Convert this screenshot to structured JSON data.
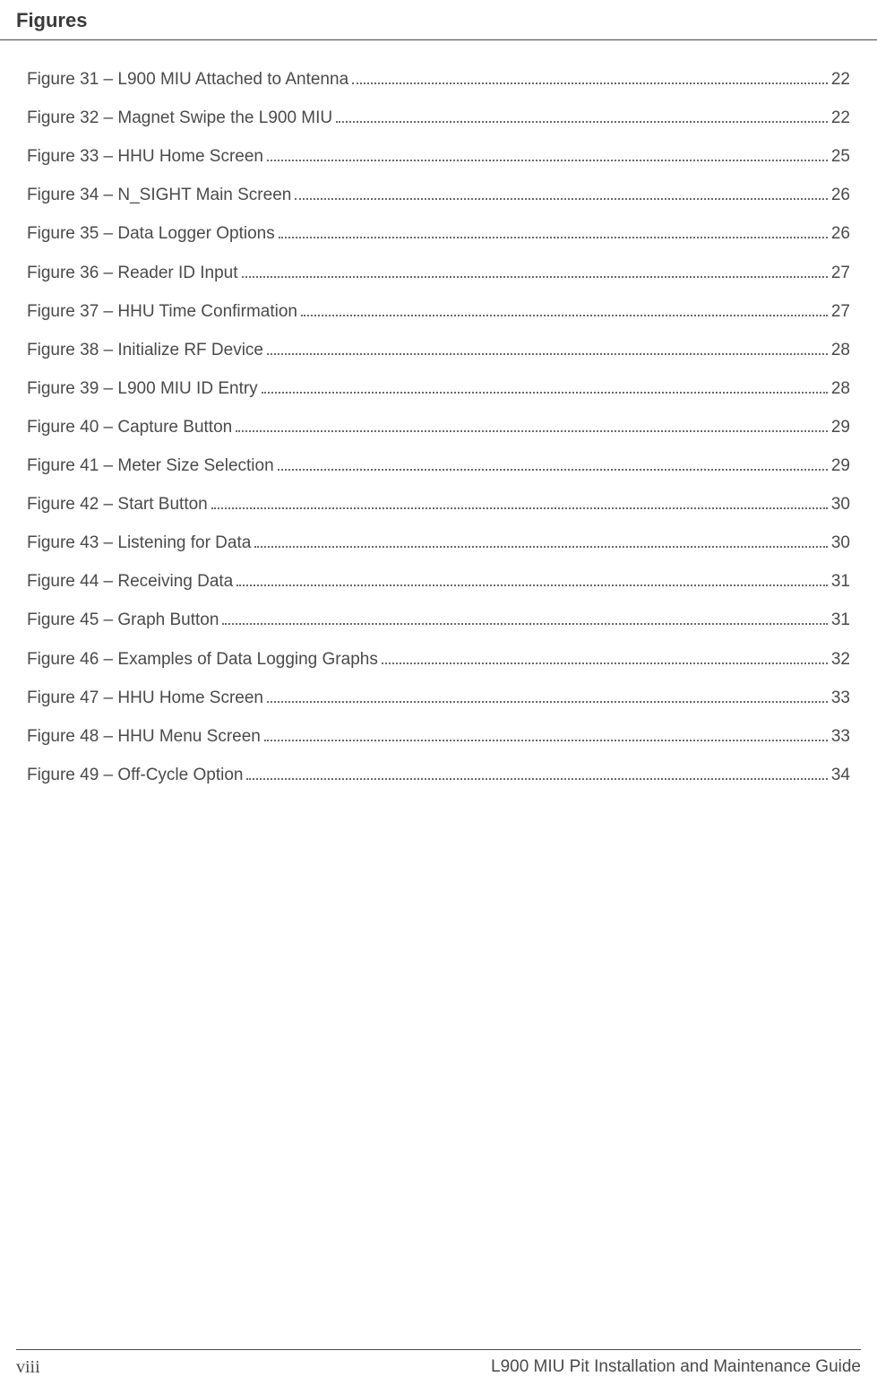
{
  "header": {
    "title": "Figures"
  },
  "figures": [
    {
      "num": "31",
      "title": "L900 MIU Attached to Antenna",
      "page": "22"
    },
    {
      "num": "32",
      "title": "Magnet Swipe the L900 MIU",
      "page": "22"
    },
    {
      "num": "33",
      "title": "HHU Home Screen",
      "page": "25"
    },
    {
      "num": "34",
      "title": "N_SIGHT Main Screen",
      "page": "26"
    },
    {
      "num": "35",
      "title": "Data Logger Options",
      "page": "26"
    },
    {
      "num": "36",
      "title": "Reader ID Input",
      "page": "27"
    },
    {
      "num": "37",
      "title": "HHU Time Confirmation",
      "page": "27"
    },
    {
      "num": "38",
      "title": "Initialize RF Device",
      "page": "28"
    },
    {
      "num": "39",
      "title": "L900 MIU ID Entry",
      "page": "28"
    },
    {
      "num": "40",
      "title": "Capture Button",
      "page": "29"
    },
    {
      "num": "41",
      "title": "Meter Size Selection",
      "page": "29"
    },
    {
      "num": "42",
      "title": "Start Button",
      "page": "30"
    },
    {
      "num": "43",
      "title": "Listening for Data",
      "page": "30"
    },
    {
      "num": "44",
      "title": "Receiving Data",
      "page": "31"
    },
    {
      "num": "45",
      "title": "Graph Button",
      "page": "31"
    },
    {
      "num": "46",
      "title": "Examples of Data Logging Graphs",
      "page": "32"
    },
    {
      "num": "47",
      "title": "HHU Home Screen",
      "page": "33"
    },
    {
      "num": "48",
      "title": "HHU Menu Screen",
      "page": "33"
    },
    {
      "num": "49",
      "title": "Off-Cycle Option",
      "page": "34"
    }
  ],
  "footer": {
    "page_number": "viii",
    "doc_title": "L900 MIU Pit Installation and Maintenance Guide"
  },
  "labels": {
    "figure_prefix": "Figure ",
    "separator": "  –  "
  }
}
